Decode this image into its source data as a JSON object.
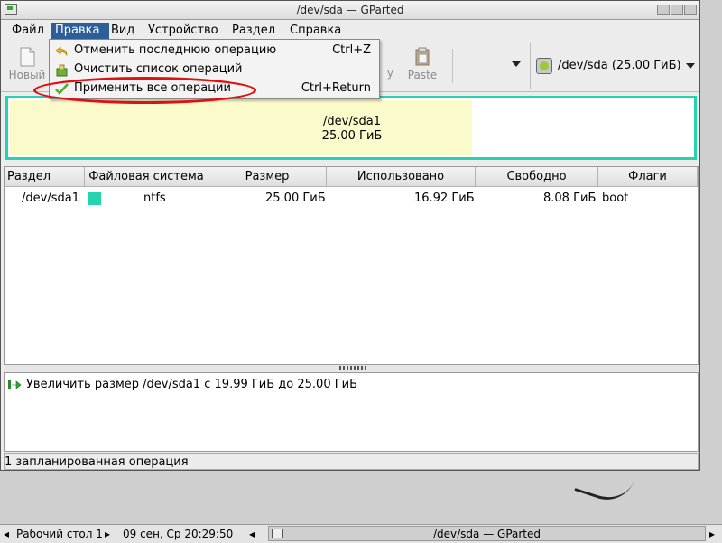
{
  "window": {
    "title": "/dev/sda — GParted"
  },
  "menubar": {
    "items": [
      {
        "label": "Файл"
      },
      {
        "label": "Правка"
      },
      {
        "label": "Вид"
      },
      {
        "label": "Устройство"
      },
      {
        "label": "Раздел"
      },
      {
        "label": "Справка"
      }
    ],
    "active": "Правка"
  },
  "edit_menu": {
    "items": [
      {
        "label": "Отменить последнюю операцию",
        "shortcut": "Ctrl+Z",
        "icon": "undo-icon"
      },
      {
        "label": "Очистить список операций",
        "shortcut": "",
        "icon": "clear-icon"
      },
      {
        "label": "Применить все операции",
        "shortcut": "Ctrl+Return",
        "icon": "apply-check-icon",
        "highlighted_by_annotation": true
      }
    ],
    "annotation_color": "#e01010"
  },
  "toolbar": {
    "new_label": "Новый",
    "copy_label_partial": "y",
    "paste_label": "Paste"
  },
  "device_selector": {
    "label": "/dev/sda  (25.00 ГиБ)"
  },
  "disk_map": {
    "partition": "/dev/sda1",
    "size": "25.00 ГиБ",
    "used_fraction": 0.67,
    "border_color": "#26d3b0",
    "used_color": "#fafacb"
  },
  "partition_table": {
    "columns": [
      "Раздел",
      "Файловая система",
      "Размер",
      "Использовано",
      "Свободно",
      "Флаги"
    ],
    "rows": [
      {
        "partition": "/dev/sda1",
        "filesystem": "ntfs",
        "size": "25.00 ГиБ",
        "used": "16.92 ГиБ",
        "free": "8.08 ГиБ",
        "flags": "boot",
        "fs_color": "#26d3b0"
      }
    ]
  },
  "operations": {
    "items": [
      {
        "text": "Увеличить размер /dev/sda1 с 19.99 ГиБ до 25.00 ГиБ",
        "icon": "resize-arrow-icon"
      }
    ]
  },
  "status_bar": {
    "text": "1 запланированная операция"
  },
  "taskbar": {
    "desktop": "Рабочий стол 1",
    "clock": "09 сен, Ср 20:29:50",
    "task": "/dev/sda — GParted"
  }
}
